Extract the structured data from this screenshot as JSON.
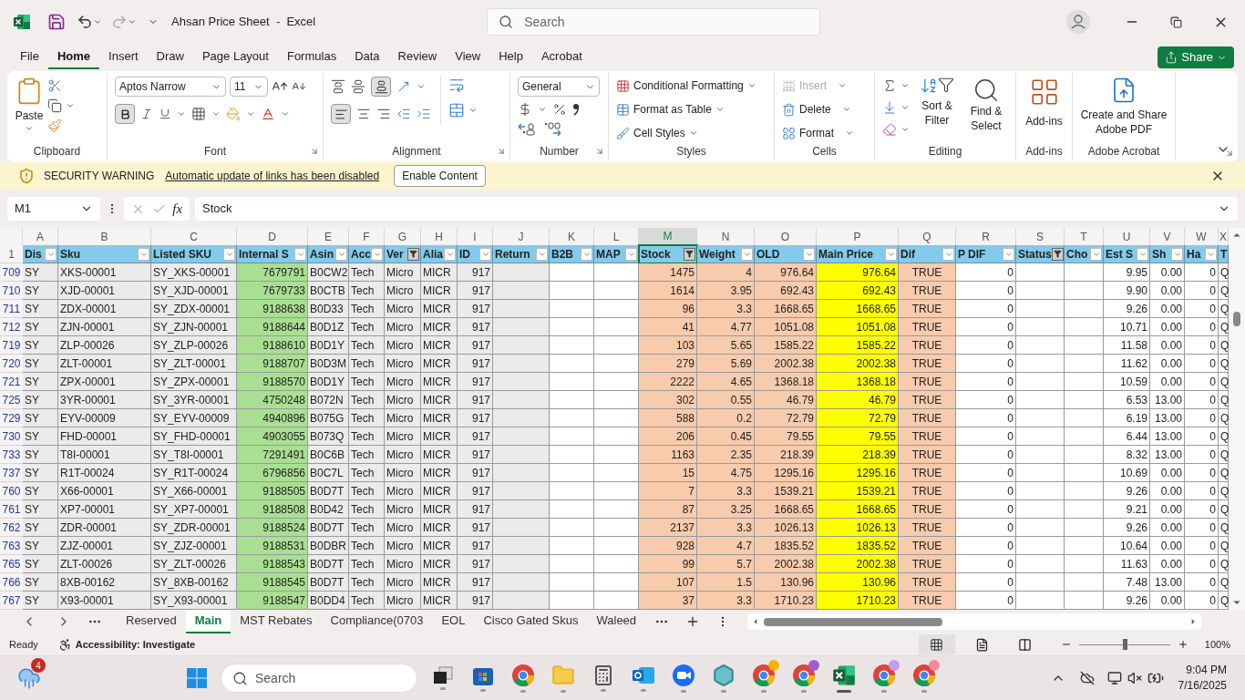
{
  "window": {
    "title": "Ahsan Price Sheet  -  Excel",
    "search_placeholder": "Search"
  },
  "menu_tabs": [
    {
      "label": "File",
      "selected": false
    },
    {
      "label": "Home",
      "selected": true
    },
    {
      "label": "Insert",
      "selected": false
    },
    {
      "label": "Draw",
      "selected": false
    },
    {
      "label": "Page Layout",
      "selected": false
    },
    {
      "label": "Formulas",
      "selected": false
    },
    {
      "label": "Data",
      "selected": false
    },
    {
      "label": "Review",
      "selected": false
    },
    {
      "label": "View",
      "selected": false
    },
    {
      "label": "Help",
      "selected": false
    },
    {
      "label": "Acrobat",
      "selected": false
    }
  ],
  "share_button": "Share",
  "ribbon": {
    "clipboard": {
      "paste": "Paste",
      "label": "Clipboard"
    },
    "font": {
      "name": "Aptos Narrow",
      "size": "11",
      "bold": true,
      "label": "Font"
    },
    "alignment": {
      "bottom_align": true,
      "align_left": true,
      "label": "Alignment"
    },
    "number": {
      "format": "General",
      "label": "Number"
    },
    "styles": {
      "items": [
        "Conditional Formatting",
        "Format as Table",
        "Cell Styles"
      ],
      "label": "Styles"
    },
    "cells": {
      "items": [
        {
          "label": "Insert",
          "disabled": true
        },
        {
          "label": "Delete",
          "disabled": false
        },
        {
          "label": "Format",
          "disabled": false
        }
      ],
      "label": "Cells"
    },
    "editing": {
      "sort": "Sort & Filter",
      "find": "Find & Select",
      "label": "Editing"
    },
    "addins": {
      "button": "Add-ins",
      "label": "Add-ins"
    },
    "acrobat": {
      "button": "Create and Share Adobe PDF",
      "label": "Adobe Acrobat"
    }
  },
  "security_bar": {
    "title": "SECURITY WARNING",
    "message": "Automatic update of links has been disabled",
    "button": "Enable Content"
  },
  "formula_bar": {
    "name_box": "M1",
    "fx": "fx",
    "formula": "Stock"
  },
  "sheet": {
    "columns": [
      {
        "letter": "A",
        "header": "Dis",
        "kind": "text",
        "color": "#ebebeb",
        "filtered": false,
        "selected": false
      },
      {
        "letter": "B",
        "header": "Sku",
        "kind": "text",
        "color": "#ebebeb",
        "filtered": false,
        "selected": false
      },
      {
        "letter": "C",
        "header": "Listed SKU",
        "kind": "text",
        "color": "#ebebeb",
        "filtered": false,
        "selected": false
      },
      {
        "letter": "D",
        "header": "Internal S",
        "kind": "number",
        "color": "#a9df92",
        "filtered": false,
        "selected": false
      },
      {
        "letter": "E",
        "header": "Asin",
        "kind": "text",
        "color": "#ebebeb",
        "filtered": false,
        "selected": false
      },
      {
        "letter": "F",
        "header": "Acc",
        "kind": "text",
        "color": "#ebebeb",
        "filtered": false,
        "selected": false
      },
      {
        "letter": "G",
        "header": "Ver",
        "kind": "text",
        "color": "#ebebeb",
        "filtered": true,
        "selected": false
      },
      {
        "letter": "H",
        "header": "Alia",
        "kind": "text",
        "color": "#ebebeb",
        "filtered": false,
        "selected": false
      },
      {
        "letter": "I",
        "header": "ID",
        "kind": "number",
        "color": "#ebebeb",
        "filtered": false,
        "selected": false
      },
      {
        "letter": "J",
        "header": "Return",
        "kind": "text",
        "color": "#ebebeb",
        "filtered": false,
        "selected": false
      },
      {
        "letter": "K",
        "header": "B2B",
        "kind": "text",
        "color": "#ffffff",
        "filtered": false,
        "selected": false
      },
      {
        "letter": "L",
        "header": "MAP",
        "kind": "text",
        "color": "#ffffff",
        "filtered": false,
        "selected": false
      },
      {
        "letter": "M",
        "header": "Stock",
        "kind": "number",
        "color": "#f8cbad",
        "filtered": true,
        "selected": true
      },
      {
        "letter": "N",
        "header": "Weight",
        "kind": "number",
        "color": "#f8cbad",
        "filtered": false,
        "selected": false
      },
      {
        "letter": "O",
        "header": "OLD",
        "kind": "number",
        "color": "#f8cbad",
        "filtered": false,
        "selected": false
      },
      {
        "letter": "P",
        "header": "Main Price",
        "kind": "number",
        "color": "#ffff00",
        "filtered": false,
        "selected": false
      },
      {
        "letter": "Q",
        "header": "Dif",
        "kind": "boolean",
        "color": "#f8cbad",
        "filtered": false,
        "selected": false
      },
      {
        "letter": "R",
        "header": "P DIF",
        "kind": "number",
        "color": "#ffffff",
        "filtered": false,
        "selected": false
      },
      {
        "letter": "S",
        "header": "Status",
        "kind": "text",
        "color": "#ffffff",
        "filtered": true,
        "selected": false
      },
      {
        "letter": "T",
        "header": "Cho",
        "kind": "text",
        "color": "#ffffff",
        "filtered": false,
        "selected": false
      },
      {
        "letter": "U",
        "header": "Est S",
        "kind": "number",
        "color": "#ffffff",
        "filtered": false,
        "selected": false
      },
      {
        "letter": "V",
        "header": "Sh",
        "kind": "number",
        "color": "#ffffff",
        "filtered": false,
        "selected": false
      },
      {
        "letter": "W",
        "header": "Ha",
        "kind": "number",
        "color": "#ffffff",
        "filtered": false,
        "selected": false
      },
      {
        "letter": "X",
        "header": "T",
        "kind": "text",
        "color": "#ffffff",
        "selected": false
      }
    ],
    "header_row": "1",
    "rows": [
      {
        "number": "709",
        "cells": [
          "SY",
          "XKS-00001",
          "SY_XKS-00001",
          "7679791",
          "B0CW2",
          "Tech",
          "Micro",
          "MICR",
          "917",
          null,
          null,
          null,
          "1475",
          "4",
          "976.64",
          "976.64",
          "TRUE",
          "0",
          null,
          null,
          "9.95",
          "0.00",
          "0",
          "Q"
        ]
      },
      {
        "number": "710",
        "cells": [
          "SY",
          "XJD-00001",
          "SY_XJD-00001",
          "7679733",
          "B0CTB",
          "Tech",
          "Micro",
          "MICR",
          "917",
          null,
          null,
          null,
          "1614",
          "3.95",
          "692.43",
          "692.43",
          "TRUE",
          "0",
          null,
          null,
          "9.90",
          "0.00",
          "0",
          "Q"
        ]
      },
      {
        "number": "711",
        "cells": [
          "SY",
          "ZDX-00001",
          "SY_ZDX-00001",
          "9188638",
          "B0D33",
          "Tech",
          "Micro",
          "MICR",
          "917",
          null,
          null,
          null,
          "96",
          "3.3",
          "1668.65",
          "1668.65",
          "TRUE",
          "0",
          null,
          null,
          "9.26",
          "0.00",
          "0",
          "Q"
        ]
      },
      {
        "number": "712",
        "cells": [
          "SY",
          "ZJN-00001",
          "SY_ZJN-00001",
          "9188644",
          "B0D1Z",
          "Tech",
          "Micro",
          "MICR",
          "917",
          null,
          null,
          null,
          "41",
          "4.77",
          "1051.08",
          "1051.08",
          "TRUE",
          "0",
          null,
          null,
          "10.71",
          "0.00",
          "0",
          "Q"
        ]
      },
      {
        "number": "719",
        "cells": [
          "SY",
          "ZLP-00026",
          "SY_ZLP-00026",
          "9188610",
          "B0D1Y",
          "Tech",
          "Micro",
          "MICR",
          "917",
          null,
          null,
          null,
          "103",
          "5.65",
          "1585.22",
          "1585.22",
          "TRUE",
          "0",
          null,
          null,
          "11.58",
          "0.00",
          "0",
          "Q"
        ]
      },
      {
        "number": "720",
        "cells": [
          "SY",
          "ZLT-00001",
          "SY_ZLT-00001",
          "9188707",
          "B0D3M",
          "Tech",
          "Micro",
          "MICR",
          "917",
          null,
          null,
          null,
          "279",
          "5.69",
          "2002.38",
          "2002.38",
          "TRUE",
          "0",
          null,
          null,
          "11.62",
          "0.00",
          "0",
          "Q"
        ]
      },
      {
        "number": "721",
        "cells": [
          "SY",
          "ZPX-00001",
          "SY_ZPX-00001",
          "9188570",
          "B0D1Y",
          "Tech",
          "Micro",
          "MICR",
          "917",
          null,
          null,
          null,
          "2222",
          "4.65",
          "1368.18",
          "1368.18",
          "TRUE",
          "0",
          null,
          null,
          "10.59",
          "0.00",
          "0",
          "Q"
        ]
      },
      {
        "number": "725",
        "cells": [
          "SY",
          "3YR-00001",
          "SY_3YR-00001",
          "4750248",
          "B072N",
          "Tech",
          "Micro",
          "MICR",
          "917",
          null,
          null,
          null,
          "302",
          "0.55",
          "46.79",
          "46.79",
          "TRUE",
          "0",
          null,
          null,
          "6.53",
          "13.00",
          "0",
          "Q"
        ]
      },
      {
        "number": "729",
        "cells": [
          "SY",
          "EYV-00009",
          "SY_EYV-00009",
          "4940896",
          "B075G",
          "Tech",
          "Micro",
          "MICR",
          "917",
          null,
          null,
          null,
          "588",
          "0.2",
          "72.79",
          "72.79",
          "TRUE",
          "0",
          null,
          null,
          "6.19",
          "13.00",
          "0",
          "Q"
        ]
      },
      {
        "number": "730",
        "cells": [
          "SY",
          "FHD-00001",
          "SY_FHD-00001",
          "4903055",
          "B073Q",
          "Tech",
          "Micro",
          "MICR",
          "917",
          null,
          null,
          null,
          "206",
          "0.45",
          "79.55",
          "79.55",
          "TRUE",
          "0",
          null,
          null,
          "6.44",
          "13.00",
          "0",
          "Q"
        ]
      },
      {
        "number": "733",
        "cells": [
          "SY",
          "T8I-00001",
          "SY_T8I-00001",
          "7291491",
          "B0C6B",
          "Tech",
          "Micro",
          "MICR",
          "917",
          null,
          null,
          null,
          "1163",
          "2.35",
          "218.39",
          "218.39",
          "TRUE",
          "0",
          null,
          null,
          "8.32",
          "13.00",
          "0",
          "Q"
        ]
      },
      {
        "number": "737",
        "cells": [
          "SY",
          "R1T-00024",
          "SY_R1T-00024",
          "6796856",
          "B0C7L",
          "Tech",
          "Micro",
          "MICR",
          "917",
          null,
          null,
          null,
          "15",
          "4.75",
          "1295.16",
          "1295.16",
          "TRUE",
          "0",
          null,
          null,
          "10.69",
          "0.00",
          "0",
          "Q"
        ]
      },
      {
        "number": "760",
        "cells": [
          "SY",
          "X66-00001",
          "SY_X66-00001",
          "9188505",
          "B0D7T",
          "Tech",
          "Micro",
          "MICR",
          "917",
          null,
          null,
          null,
          "7",
          "3.3",
          "1539.21",
          "1539.21",
          "TRUE",
          "0",
          null,
          null,
          "9.26",
          "0.00",
          "0",
          "Q"
        ]
      },
      {
        "number": "761",
        "cells": [
          "SY",
          "XP7-00001",
          "SY_XP7-00001",
          "9188508",
          "B0D42",
          "Tech",
          "Micro",
          "MICR",
          "917",
          null,
          null,
          null,
          "87",
          "3.25",
          "1668.65",
          "1668.65",
          "TRUE",
          "0",
          null,
          null,
          "9.21",
          "0.00",
          "0",
          "Q"
        ]
      },
      {
        "number": "762",
        "cells": [
          "SY",
          "ZDR-00001",
          "SY_ZDR-00001",
          "9188524",
          "B0D7T",
          "Tech",
          "Micro",
          "MICR",
          "917",
          null,
          null,
          null,
          "2137",
          "3.3",
          "1026.13",
          "1026.13",
          "TRUE",
          "0",
          null,
          null,
          "9.26",
          "0.00",
          "0",
          "Q"
        ]
      },
      {
        "number": "763",
        "cells": [
          "SY",
          "ZJZ-00001",
          "SY_ZJZ-00001",
          "9188531",
          "B0DBR",
          "Tech",
          "Micro",
          "MICR",
          "917",
          null,
          null,
          null,
          "928",
          "4.7",
          "1835.52",
          "1835.52",
          "TRUE",
          "0",
          null,
          null,
          "10.64",
          "0.00",
          "0",
          "Q"
        ]
      },
      {
        "number": "765",
        "cells": [
          "SY",
          "ZLT-00026",
          "SY_ZLT-00026",
          "9188543",
          "B0D7T",
          "Tech",
          "Micro",
          "MICR",
          "917",
          null,
          null,
          null,
          "99",
          "5.7",
          "2002.38",
          "2002.38",
          "TRUE",
          "0",
          null,
          null,
          "11.63",
          "0.00",
          "0",
          "Q"
        ]
      },
      {
        "number": "766",
        "cells": [
          "SY",
          "8XB-00162",
          "SY_8XB-00162",
          "9188545",
          "B0D7T",
          "Tech",
          "Micro",
          "MICR",
          "917",
          null,
          null,
          null,
          "107",
          "1.5",
          "130.96",
          "130.96",
          "TRUE",
          "0",
          null,
          null,
          "7.48",
          "13.00",
          "0",
          "Q"
        ]
      },
      {
        "number": "767",
        "cells": [
          "SY",
          "X93-00001",
          "SY_X93-00001",
          "9188547",
          "B0DD4",
          "Tech",
          "Micro",
          "MICR",
          "917",
          null,
          null,
          null,
          "37",
          "3.3",
          "1710.23",
          "1710.23",
          "TRUE",
          "0",
          null,
          null,
          "9.26",
          "0.00",
          "0",
          "Q"
        ]
      }
    ]
  },
  "sheet_tabs": [
    {
      "label": "Reserved",
      "selected": false
    },
    {
      "label": "Main",
      "selected": true
    },
    {
      "label": "MST Rebates",
      "selected": false
    },
    {
      "label": "Compliance(0703",
      "selected": false
    },
    {
      "label": "EOL",
      "selected": false
    },
    {
      "label": "Cisco Gated Skus",
      "selected": false
    },
    {
      "label": "Waleed",
      "selected": false
    }
  ],
  "status_bar": {
    "mode": "Ready",
    "accessibility": "Accessibility: Investigate",
    "zoom": {
      "level": 0.5,
      "reading": "100%"
    }
  },
  "taskbar": {
    "weather_badge": "4",
    "search_placeholder": "Search",
    "apps": [
      {
        "kind": "taskview",
        "active": false
      },
      {
        "kind": "store",
        "active": false
      },
      {
        "kind": "chrome",
        "active": false
      },
      {
        "kind": "folder",
        "active": false
      },
      {
        "kind": "calculator",
        "active": false
      },
      {
        "kind": "outlook",
        "active": false
      },
      {
        "kind": "zoom",
        "active": false
      },
      {
        "kind": "app",
        "active": false
      },
      {
        "kind": "chrome",
        "active": false,
        "color": "#f4b400"
      },
      {
        "kind": "chrome",
        "active": false,
        "color": "#a05cd6"
      },
      {
        "kind": "excel",
        "active": true
      },
      {
        "kind": "chrome",
        "active": false,
        "color": "#c79bf0"
      },
      {
        "kind": "chrome",
        "active": false,
        "color": "#f28b9b"
      }
    ],
    "time": "9:04 PM",
    "date": "7/16/2025"
  }
}
